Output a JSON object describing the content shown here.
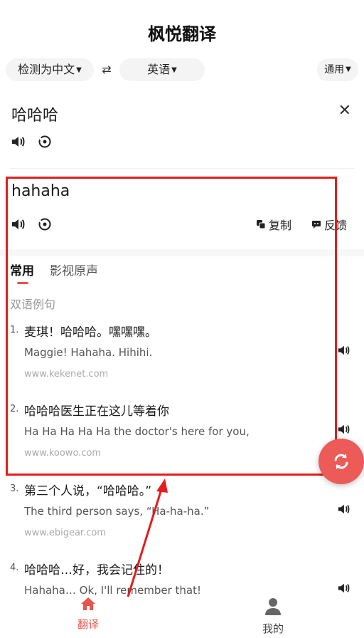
{
  "header": {
    "title": "枫悦翻译"
  },
  "lang_bar": {
    "source_lang": "检测为中文",
    "target_lang": "英语",
    "domain": "通用"
  },
  "source": {
    "text": "哈哈哈"
  },
  "result": {
    "text": "hahaha",
    "copy_label": "复制",
    "feedback_label": "反馈"
  },
  "tabs": [
    {
      "label": "常用",
      "active": true
    },
    {
      "label": "影视原声",
      "active": false
    }
  ],
  "examples_section": {
    "title": "双语例句",
    "items": [
      {
        "num": "1.",
        "zh": "麦琪！哈哈哈。嘿嘿嘿。",
        "en": "Maggie! Hahaha. Hihihi.",
        "source": "www.kekenet.com"
      },
      {
        "num": "2.",
        "zh": "哈哈哈医生正在这儿等着你",
        "en": "Ha Ha Ha Ha Ha the doctor's here for you,",
        "source": "www.koowo.com"
      },
      {
        "num": "3.",
        "zh": "第三个人说，“哈哈哈。”",
        "en": "The third person says, “Ha-ha-ha.”",
        "source": "www.ebigear.com"
      },
      {
        "num": "4.",
        "zh": "哈哈哈…好，我会记住的！",
        "en": "Hahaha… Ok, I'll remember that!",
        "source": ""
      }
    ]
  },
  "bottom_nav": {
    "translate_label": "翻译",
    "mine_label": "我的"
  },
  "colors": {
    "accent": "#e8544f",
    "highlight_box": "#e31d1d",
    "fab": "#ec5b57"
  }
}
